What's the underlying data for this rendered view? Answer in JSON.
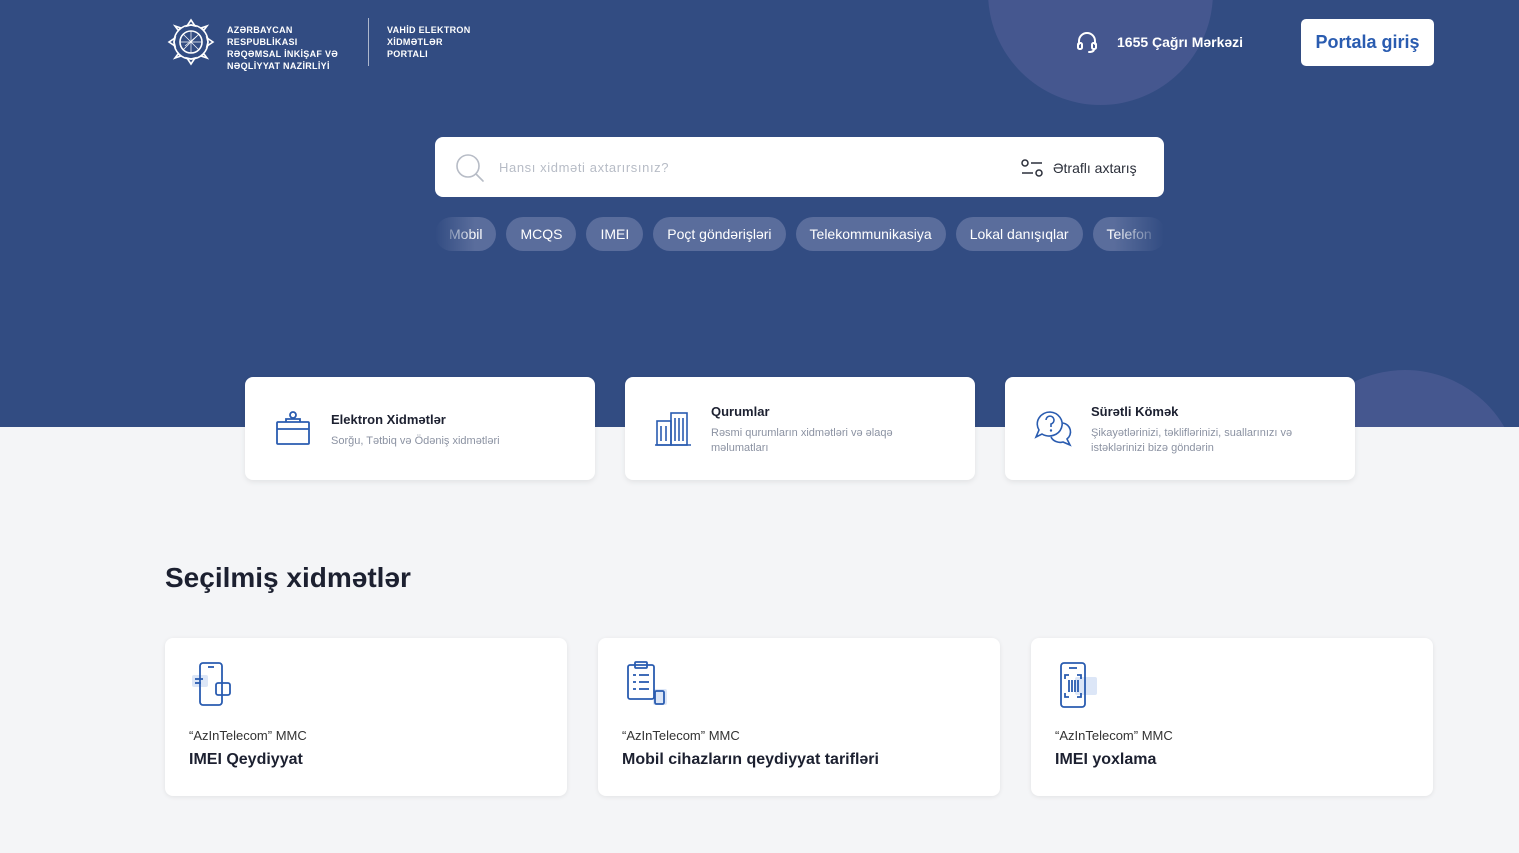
{
  "header": {
    "ministry_lines": [
      "AZƏRBAYCAN RESPUBLİKASI",
      "RƏQƏMSAL İNKİŞAF VƏ",
      "NƏQLİYYAT NAZİRLİYİ"
    ],
    "portal_lines": [
      "VAHİD ELEKTRON",
      "XİDMƏTLƏR",
      "PORTALI"
    ],
    "call_center": "1655 Çağrı Mərkəzi",
    "login_label": "Portala giriş"
  },
  "search": {
    "placeholder": "Hansı xidməti axtarırsınız?",
    "advanced_label": "Ətraflı axtarış"
  },
  "chips": [
    "Mobil",
    "MCQS",
    "IMEI",
    "Poçt göndərişləri",
    "Telekommunikasiya",
    "Lokal danışıqlar",
    "Telefon"
  ],
  "quick_cards": [
    {
      "title": "Elektron Xidmətlər",
      "desc": "Sorğu, Tətbiq və Ödəniş xidmətləri",
      "icon": "service-desk-icon"
    },
    {
      "title": "Qurumlar",
      "desc": "Rəsmi qurumların xidmətləri və əlaqə məlumatları",
      "icon": "buildings-icon"
    },
    {
      "title": "Sürətli Kömək",
      "desc": "Şikayətlərinizi, təkliflərinizi, suallarınızı və istəklərinizi bizə göndərin",
      "icon": "question-chat-icon"
    }
  ],
  "featured": {
    "title": "Seçilmiş xidmətlər",
    "cards": [
      {
        "org": "“AzInTelecom” MMC",
        "name": "IMEI Qeydiyyat",
        "icon": "phone-register-icon"
      },
      {
        "org": "“AzInTelecom” MMC",
        "name": "Mobil cihazların qeydiyyat tarifləri",
        "icon": "clipboard-phone-icon"
      },
      {
        "org": "“AzInTelecom” MMC",
        "name": "IMEI yoxlama",
        "icon": "phone-barcode-icon"
      }
    ]
  },
  "colors": {
    "hero_bg": "#324c82",
    "accent": "#2a5cb0",
    "chip_bg": "#5a6d9c",
    "page_bg": "#f4f5f7"
  }
}
